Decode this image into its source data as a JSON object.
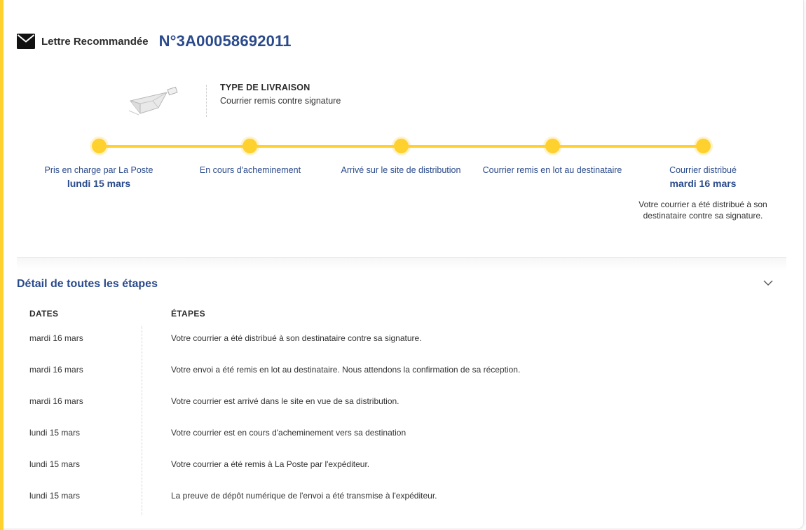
{
  "header": {
    "type_label": "Lettre Recommandée",
    "tracking_number": "N°3A00058692011"
  },
  "delivery": {
    "title": "TYPE DE LIVRAISON",
    "value": "Courrier remis contre signature"
  },
  "timeline": {
    "steps": [
      {
        "label": "Pris en charge par La Poste",
        "date": "lundi 15 mars",
        "desc": ""
      },
      {
        "label": "En cours d'acheminement",
        "date": "",
        "desc": ""
      },
      {
        "label": "Arrivé sur le site de distribution",
        "date": "",
        "desc": ""
      },
      {
        "label": "Courrier remis en lot au destinataire",
        "date": "",
        "desc": ""
      },
      {
        "label": "Courrier distribué",
        "date": "mardi 16 mars",
        "desc": "Votre courrier a été distribué à son destinataire contre sa signature."
      }
    ]
  },
  "detail": {
    "title": "Détail de toutes les étapes",
    "col_dates": "DATES",
    "col_steps": "ÉTAPES",
    "rows": [
      {
        "date": "mardi 16 mars",
        "step": "Votre courrier a été distribué à son destinataire contre sa signature."
      },
      {
        "date": "mardi 16 mars",
        "step": "Votre envoi a été remis en lot au destinataire. Nous attendons la confirmation de sa réception."
      },
      {
        "date": "mardi 16 mars",
        "step": "Votre courrier est arrivé dans le site en vue de sa distribution."
      },
      {
        "date": "lundi 15 mars",
        "step": "Votre courrier est en cours d'acheminement vers sa destination"
      },
      {
        "date": "lundi 15 mars",
        "step": "Votre courrier a été remis à La Poste par l'expéditeur."
      },
      {
        "date": "lundi 15 mars",
        "step": "La preuve de dépôt numérique de l'envoi a été transmise à l'expéditeur."
      }
    ]
  },
  "colors": {
    "accent_yellow": "#ffd12f",
    "brand_blue": "#2a4a8b"
  },
  "icons": {
    "header": "envelope-icon",
    "delivery": "delivery-illustration",
    "toggle": "chevron-down-icon"
  }
}
